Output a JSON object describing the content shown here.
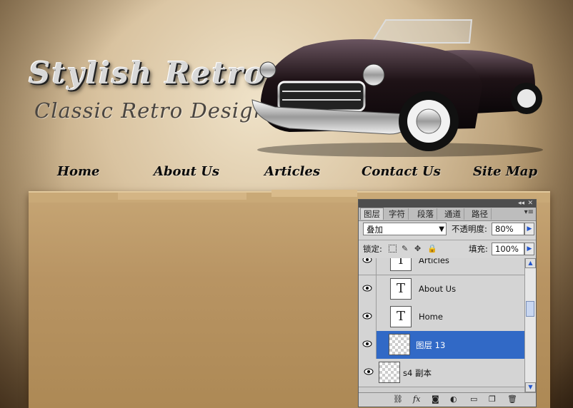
{
  "site": {
    "logo_title": "Stylish Retro",
    "logo_subtitle": "Classic Retro Design",
    "nav": [
      "Home",
      "About Us",
      "Articles",
      "Contact Us",
      "Site Map"
    ]
  },
  "panel": {
    "tabs": [
      "图层",
      "字符",
      "段落",
      "通道",
      "路径"
    ],
    "blend_mode": "叠加",
    "opacity_label": "不透明度:",
    "opacity_value": "80%",
    "lock_label": "锁定:",
    "fill_label": "填充:",
    "fill_value": "100%",
    "layers": [
      {
        "name": "Articles",
        "type": "text",
        "selected": false
      },
      {
        "name": "About Us",
        "type": "text",
        "selected": false
      },
      {
        "name": "Home",
        "type": "text",
        "selected": false
      },
      {
        "name": "图层 13",
        "type": "raster",
        "selected": true
      },
      {
        "name": "s4 副本",
        "type": "raster",
        "selected": false
      }
    ],
    "text_thumb_glyph": "T"
  },
  "colors": {
    "selection": "#3169c6",
    "panel_bg": "#d6d6d6"
  }
}
